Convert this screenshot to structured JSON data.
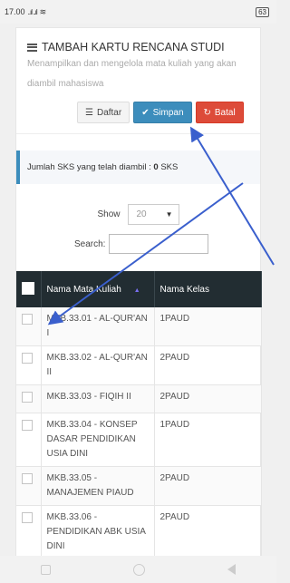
{
  "status_bar": {
    "time": "17.00",
    "signal": "..ıl ..ıl",
    "wifi": "📶",
    "battery": "63"
  },
  "header": {
    "title": "TAMBAH KARTU RENCANA STUDI",
    "subtitle": "Menampilkan dan mengelola mata kuliah yang akan diambil mahasiswa"
  },
  "buttons": {
    "daftar": "Daftar",
    "simpan": "Simpan",
    "batal": "Batal"
  },
  "sks": {
    "label": "Jumlah SKS yang telah diambil : ",
    "value": "0",
    "unit": " SKS"
  },
  "controls": {
    "show_label": "Show",
    "show_value": "20",
    "search_label": "Search:"
  },
  "table": {
    "headers": [
      "Nama Mata Kuliah",
      "Nama Kelas"
    ],
    "rows": [
      {
        "course": "MKB.33.01 - AL-QUR'AN I",
        "class": "1PAUD"
      },
      {
        "course": "MKB.33.02 - AL-QUR'AN II",
        "class": "2PAUD"
      },
      {
        "course": "MKB.33.03 - FIQIH II",
        "class": "2PAUD"
      },
      {
        "course": "MKB.33.04 - KONSEP DASAR PENDIDIKAN USIA DINI",
        "class": "1PAUD"
      },
      {
        "course": "MKB.33.05 - MANAJEMEN PIAUD",
        "class": "2PAUD"
      },
      {
        "course": "MKB.33.06 - PENDIDIKAN ABK USIA DINI",
        "class": "2PAUD"
      }
    ]
  },
  "colors": {
    "primary": "#3c8dbc",
    "danger": "#dd4b39",
    "table_header": "#222d32",
    "annotation_arrow": "#3a5fcd"
  },
  "annotation_arrows": [
    {
      "from": "bottom-right",
      "to": "simpan-button"
    },
    {
      "from": "bottom-right",
      "to": "first-row-checkbox"
    }
  ]
}
